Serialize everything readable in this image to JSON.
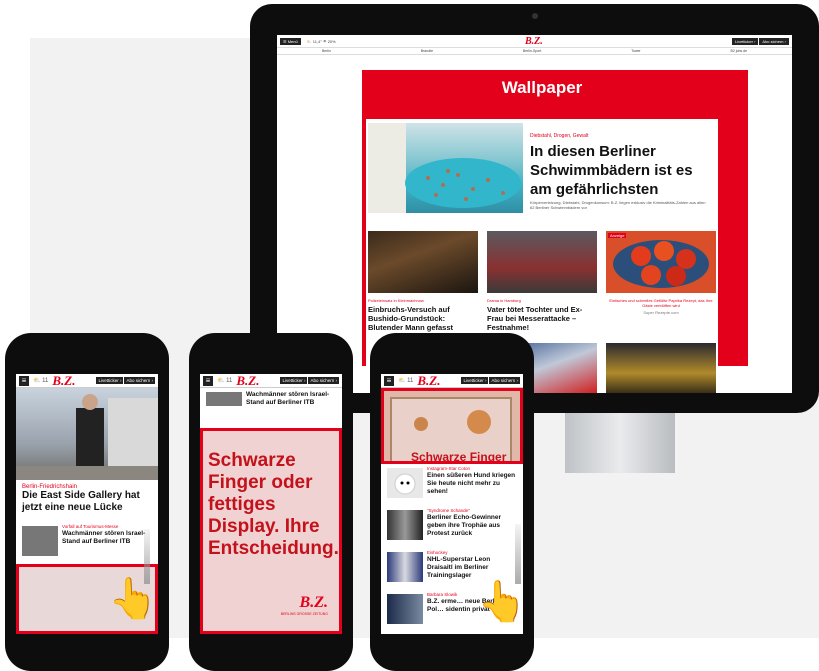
{
  "desktop": {
    "menu_label": "☰ Menü",
    "weather": "⛅ 11,4° ☂ 20%",
    "logo": "B.Z.",
    "top_buttons": [
      "Livetticker ›",
      "Abo sichern ›"
    ],
    "nav": [
      "Berlin",
      "Brandte",
      "Berlin-Sport",
      "Tower",
      "B2 jobs.de"
    ],
    "wallpaper_label": "Wallpaper",
    "lead": {
      "kicker": "Diebstahl, Drogen, Gewalt",
      "headline": "In diesen Berliner Schwimmbädern ist es am gefährlichsten",
      "teaser": "Körperverletzung, Diebstahl, Drogenkonsum: B.Z. liegen exklusiv die Kriminalitäts-Zahlen aus allen 62 Berliner Schwimmbädern vor"
    },
    "cards": [
      {
        "kicker": "Polizeieinsatz in Kleinmachnow",
        "headline": "Einbruchs-Versuch auf Bushido-Grundstück: Blutender Mann gefasst"
      },
      {
        "kicker": "Drama in Hamburg",
        "headline": "Vater tötet Tochter und Ex-Frau bei Messerattacke – Festnahme!"
      },
      {
        "badge": "Anzeige",
        "promo": "Einfaches und schnelles Gefüllte Paprika Rezept, das Ihre Gäste verblüffen wird",
        "sponsor": "Super Rezepte.com"
      }
    ]
  },
  "phones": {
    "weather": "⛅ 11",
    "logo": "B.Z.",
    "buttons": [
      "Livetticker ›",
      "Abo sichern ›"
    ],
    "menu": "≡",
    "phone1": {
      "kicker": "Berlin-Friedrichshain",
      "headline": "Die East Side Gallery hat jetzt eine neue Lücke",
      "row_kicker": "Vorfall auf Tourismus-Messe",
      "row_headline": "Wachmänner stören Israel-Stand auf Berliner ITB"
    },
    "phone2": {
      "top_headline": "Wachmänner stören Israel-Stand auf Berliner ITB",
      "ad_text": "Schwarze Finger oder fettiges Display. Ihre Entscheidung.",
      "ad_logo": "B.Z.",
      "ad_sub": "BERLINS GROSSE ZEITUNG"
    },
    "phone3": {
      "ad_text": "Schwarze Finger",
      "items": [
        {
          "kicker": "Instagram-Star Coton",
          "headline": "Einen süßeren Hund kriegen Sie heute nicht mehr zu sehen!"
        },
        {
          "kicker": "\"Syndrome Schande\"",
          "headline": "Berliner Echo-Gewinner geben ihre Trophäe aus Protest zurück"
        },
        {
          "kicker": "Eishockey",
          "headline": "NHL-Superstar Leon Draisaitl im Berliner Trainingslager"
        },
        {
          "kicker": "Barbara Slowik",
          "headline": "B.Z. erme… neue Berliner Pol… sidentin privat ist"
        }
      ]
    }
  },
  "colors": {
    "brand_red": "#e2001a",
    "device_black": "#0d0d0d"
  }
}
